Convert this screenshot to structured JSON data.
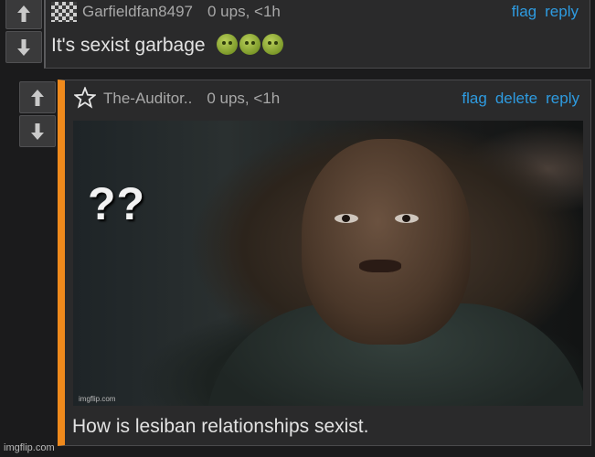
{
  "colors": {
    "background": "#1b1b1c",
    "panel": "#2a2a2b",
    "link": "#2e9be0",
    "accent_bar": "#f08a1c",
    "meta_text": "#a8a8a8"
  },
  "comments": [
    {
      "avatar_icon": "checkerboard-avatar-icon",
      "username": "Garfieldfan8497",
      "ups": "0 ups, <1h",
      "actions": [
        "flag",
        "reply"
      ],
      "text": "It's sexist garbage",
      "emojis": [
        "nauseated-face-icon",
        "nauseated-face-icon",
        "nauseated-face-icon"
      ]
    },
    {
      "avatar_icon": "star-outline-icon",
      "username": "The-Auditor..",
      "ups": "0 ups, <1h",
      "actions": [
        "flag",
        "delete",
        "reply"
      ],
      "image": {
        "overlay_text": "??",
        "watermark": "imgflip.com"
      },
      "text": "How is lesiban relationships sexist."
    }
  ],
  "vote": {
    "up_icon": "upvote-arrow-icon",
    "down_icon": "downvote-arrow-icon"
  },
  "page_watermark": "imgflip.com"
}
